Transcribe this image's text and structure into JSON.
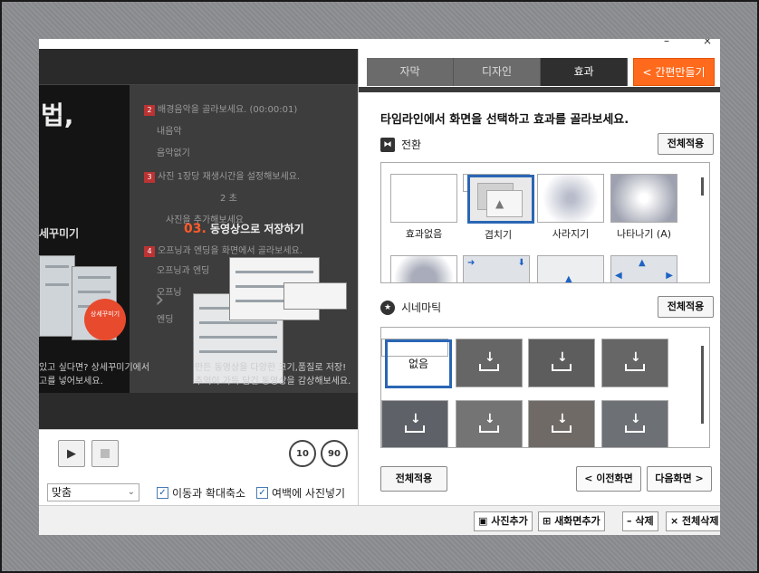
{
  "window": {
    "minimize": "–",
    "close": "×"
  },
  "preview": {
    "big_text": "법,",
    "side_label": "세꾸미기",
    "steps": [
      {
        "n": "2",
        "text": "배경음악을 골라보세요. (00:00:01)"
      },
      {
        "n": "3",
        "text": "사진 1장당 재생시간을 설정해보세요."
      },
      {
        "n": "4",
        "text": "오프닝과 엔딩을 화면에서 골라보세요."
      }
    ],
    "step_bits": [
      "내음악",
      "음악없기",
      "2",
      "초",
      "사진을 추가해보세요",
      "오프닝과 엔딩",
      "오프닝",
      "엔딩"
    ],
    "save_num": "03.",
    "save_text": "동영상으로 저장하기",
    "badge_text": "상세꾸미기",
    "caption_left": [
      "있고 싶다면? 상세꾸미기에서",
      "고를 넣어보세요."
    ],
    "caption_right": [
      "만든 동영상을 다양한 크기,품질로 저장!",
      "추억이 가득 담긴 동영상을 감상해보세요."
    ]
  },
  "controls": {
    "play": "▶",
    "rew": "10",
    "fwd": "90",
    "fit_label": "맞춤",
    "chk1": "이동과 확대축소",
    "chk2": "여백에 사진넣기",
    "check_mark": "✓"
  },
  "tabs": [
    {
      "label": "자막"
    },
    {
      "label": "디자인"
    },
    {
      "label": "효과"
    }
  ],
  "easy_tab": "< 간편만들기",
  "instruction": "타임라인에서 화면을 선택하고 효과를 골라보세요.",
  "transition": {
    "title": "전환",
    "apply_all": "전체적용",
    "items": [
      "효과없음",
      "겹치기",
      "사라지기",
      "나타나기 (A)"
    ]
  },
  "cinematic": {
    "title": "시네마틱",
    "apply_all": "전체적용",
    "none_label": "없음"
  },
  "bottom": {
    "apply_all": "전체적용",
    "prev": "< 이전화면",
    "next": "다음화면 >",
    "add_photo": "사진추가",
    "new_screen": "새화면추가",
    "delete": "– 삭제",
    "delete_all": "× 전체삭제"
  }
}
